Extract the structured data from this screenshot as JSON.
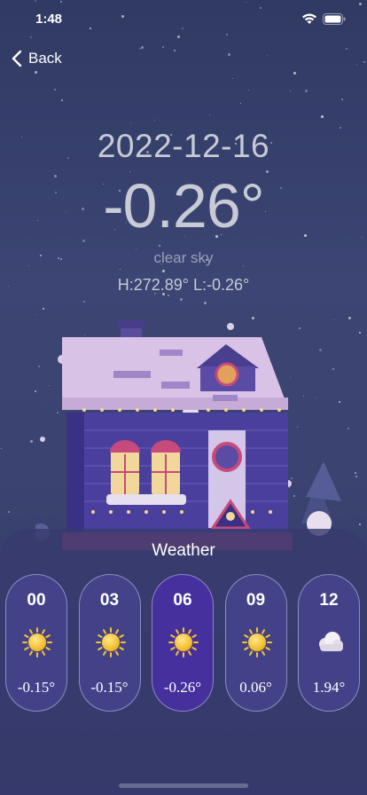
{
  "status": {
    "time": "1:48"
  },
  "nav": {
    "back_label": "Back"
  },
  "weather": {
    "date": "2022-12-16",
    "temperature": "-0.26°",
    "description": "clear sky",
    "high_low": "H:272.89°  L:-0.26°"
  },
  "forecast": {
    "title": "Weather",
    "hours": [
      {
        "hour": "00",
        "temp": "-0.15°",
        "icon": "sun-icon"
      },
      {
        "hour": "03",
        "temp": "-0.15°",
        "icon": "sun-icon"
      },
      {
        "hour": "06",
        "temp": "-0.26°",
        "icon": "sun-icon"
      },
      {
        "hour": "09",
        "temp": "0.06°",
        "icon": "sun-icon"
      },
      {
        "hour": "12",
        "temp": "1.94°",
        "icon": "cloud-icon"
      }
    ],
    "selected_index": 2
  },
  "colors": {
    "background": "#3c4573",
    "panel": "#383b6e",
    "card": "#4e48a0",
    "card_selected": "#45309e",
    "sun": "#f5c431"
  }
}
